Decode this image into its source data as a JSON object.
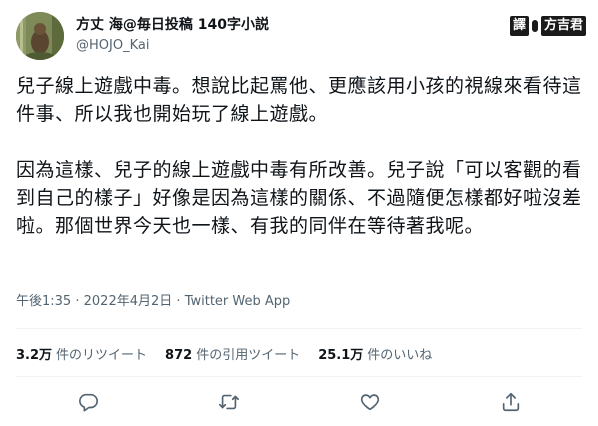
{
  "author": {
    "display_name": "方丈 海@毎日投稿 140字小説",
    "handle": "@HOJO_Kai"
  },
  "translate_badge": {
    "left": "譯",
    "right": "方吉君"
  },
  "tweet": {
    "paragraph_1": "兒子線上遊戲中毒。想說比起罵他、更應該用小孩的視線來看待這件事、所以我也開始玩了線上遊戲。",
    "paragraph_2": "因為這樣、兒子的線上遊戲中毒有所改善。兒子說「可以客觀的看到自己的樣子」好像是因為這樣的關係、不過隨便怎樣都好啦沒差啦。那個世界今天也一樣、有我的同伴在等待著我呢。"
  },
  "meta": {
    "time": "午後1:35",
    "separator": "·",
    "date": "2022年4月2日",
    "source": "Twitter Web App"
  },
  "stats": {
    "retweets": {
      "count": "3.2万",
      "label": "件のリツイート"
    },
    "quotes": {
      "count": "872",
      "label": "件の引用ツイート"
    },
    "likes": {
      "count": "25.1万",
      "label": "件のいいね"
    }
  },
  "actions": [
    "reply-icon",
    "retweet-icon",
    "like-icon",
    "share-icon"
  ],
  "colors": {
    "text": "#0f1419",
    "secondary": "#536471",
    "divider": "#eff3f4"
  }
}
